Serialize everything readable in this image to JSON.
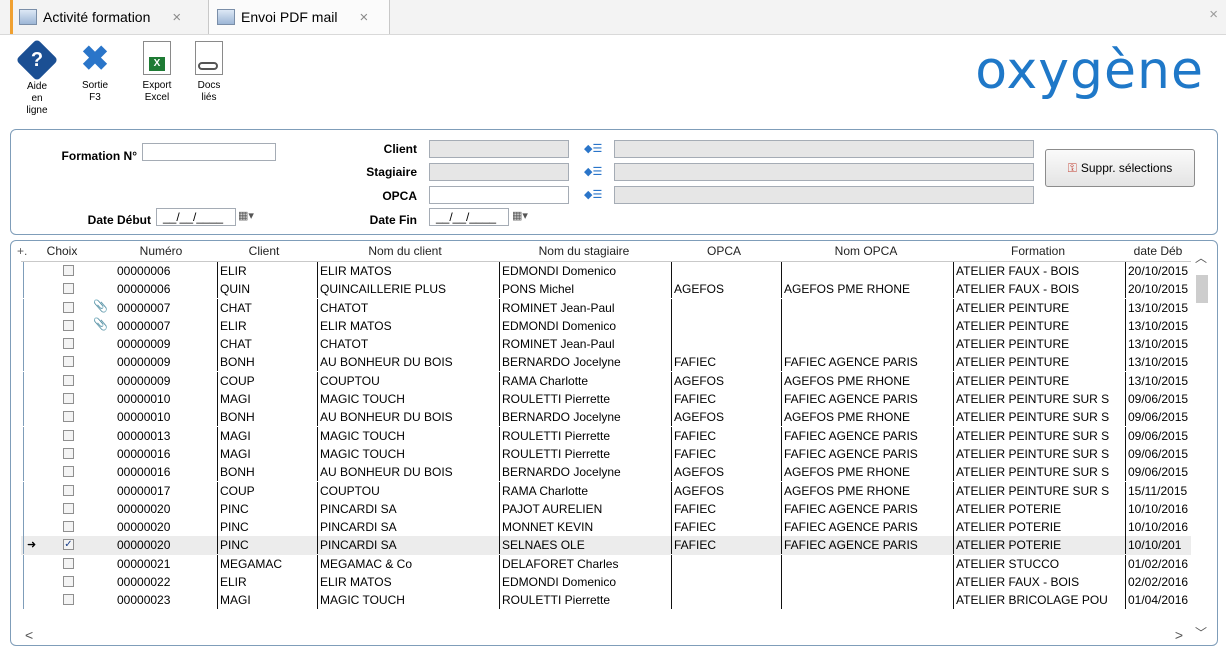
{
  "tabs": [
    {
      "label": "Activité formation",
      "close": "×"
    },
    {
      "label": "Envoi PDF mail",
      "close": "×"
    }
  ],
  "window_close": "×",
  "toolbar": {
    "help": {
      "line1": "Aide",
      "line2": "en",
      "line3": "ligne"
    },
    "exit": {
      "line1": "Sortie",
      "line2": "F3"
    },
    "export": {
      "line1": "Export",
      "line2": "Excel"
    },
    "docs": {
      "line1": "Docs",
      "line2": "liés"
    }
  },
  "logo": "oxygène",
  "filters": {
    "formation_label": "Formation N°",
    "formation_value": "",
    "date_debut_label": "Date Début",
    "date_debut_value": "__/__/____",
    "client_label": "Client",
    "stagiaire_label": "Stagiaire",
    "opca_label": "OPCA",
    "date_fin_label": "Date Fin",
    "date_fin_value": "__/__/____",
    "suppr_label": "Suppr. sélections"
  },
  "grid": {
    "columns": {
      "choix": "Choix",
      "numero": "Numéro",
      "client": "Client",
      "nom_client": "Nom du client",
      "nom_stagiaire": "Nom du stagiaire",
      "opca": "OPCA",
      "nom_opca": "Nom OPCA",
      "formation": "Formation",
      "date_debut": "date Déb"
    },
    "rows": [
      {
        "checked": false,
        "clip": false,
        "numero": "00000006",
        "client": "ELIR",
        "nom_client": "ELIR MATOS",
        "stagiaire": "EDMONDI Domenico",
        "opca": "",
        "nom_opca": "",
        "formation": "ATELIER FAUX - BOIS",
        "date": "20/10/2015"
      },
      {
        "checked": false,
        "clip": false,
        "numero": "00000006",
        "client": "QUIN",
        "nom_client": "QUINCAILLERIE PLUS",
        "stagiaire": "PONS Michel",
        "opca": "AGEFOS",
        "nom_opca": "AGEFOS PME RHONE",
        "formation": "ATELIER FAUX - BOIS",
        "date": "20/10/2015"
      },
      {
        "checked": false,
        "clip": true,
        "numero": "00000007",
        "client": "CHAT",
        "nom_client": "CHATOT",
        "stagiaire": "ROMINET Jean-Paul",
        "opca": "",
        "nom_opca": "",
        "formation": "ATELIER PEINTURE",
        "date": "13/10/2015"
      },
      {
        "checked": false,
        "clip": true,
        "numero": "00000007",
        "client": "ELIR",
        "nom_client": "ELIR MATOS",
        "stagiaire": "EDMONDI Domenico",
        "opca": "",
        "nom_opca": "",
        "formation": "ATELIER PEINTURE",
        "date": "13/10/2015"
      },
      {
        "checked": false,
        "clip": false,
        "numero": "00000009",
        "client": "CHAT",
        "nom_client": "CHATOT",
        "stagiaire": "ROMINET Jean-Paul",
        "opca": "",
        "nom_opca": "",
        "formation": "ATELIER PEINTURE",
        "date": "13/10/2015"
      },
      {
        "checked": false,
        "clip": false,
        "numero": "00000009",
        "client": "BONH",
        "nom_client": "AU BONHEUR DU BOIS",
        "stagiaire": "BERNARDO Jocelyne",
        "opca": "FAFIEC",
        "nom_opca": "FAFIEC AGENCE PARIS",
        "formation": "ATELIER PEINTURE",
        "date": "13/10/2015"
      },
      {
        "checked": false,
        "clip": false,
        "numero": "00000009",
        "client": "COUP",
        "nom_client": "COUPTOU",
        "stagiaire": "RAMA Charlotte",
        "opca": "AGEFOS",
        "nom_opca": "AGEFOS PME RHONE",
        "formation": "ATELIER PEINTURE",
        "date": "13/10/2015"
      },
      {
        "checked": false,
        "clip": false,
        "numero": "00000010",
        "client": "MAGI",
        "nom_client": "MAGIC TOUCH",
        "stagiaire": "ROULETTI Pierrette",
        "opca": "FAFIEC",
        "nom_opca": "FAFIEC AGENCE PARIS",
        "formation": "ATELIER PEINTURE SUR S",
        "date": "09/06/2015"
      },
      {
        "checked": false,
        "clip": false,
        "numero": "00000010",
        "client": "BONH",
        "nom_client": "AU BONHEUR DU BOIS",
        "stagiaire": "BERNARDO Jocelyne",
        "opca": "AGEFOS",
        "nom_opca": "AGEFOS PME RHONE",
        "formation": "ATELIER PEINTURE SUR S",
        "date": "09/06/2015"
      },
      {
        "checked": false,
        "clip": false,
        "numero": "00000013",
        "client": "MAGI",
        "nom_client": "MAGIC TOUCH",
        "stagiaire": "ROULETTI Pierrette",
        "opca": "FAFIEC",
        "nom_opca": "FAFIEC AGENCE PARIS",
        "formation": "ATELIER PEINTURE SUR S",
        "date": "09/06/2015"
      },
      {
        "checked": false,
        "clip": false,
        "numero": "00000016",
        "client": "MAGI",
        "nom_client": "MAGIC TOUCH",
        "stagiaire": "ROULETTI Pierrette",
        "opca": "FAFIEC",
        "nom_opca": "FAFIEC AGENCE PARIS",
        "formation": "ATELIER PEINTURE SUR S",
        "date": "09/06/2015"
      },
      {
        "checked": false,
        "clip": false,
        "numero": "00000016",
        "client": "BONH",
        "nom_client": "AU BONHEUR DU BOIS",
        "stagiaire": "BERNARDO Jocelyne",
        "opca": "AGEFOS",
        "nom_opca": "AGEFOS PME RHONE",
        "formation": "ATELIER PEINTURE SUR S",
        "date": "09/06/2015"
      },
      {
        "checked": false,
        "clip": false,
        "numero": "00000017",
        "client": "COUP",
        "nom_client": "COUPTOU",
        "stagiaire": "RAMA Charlotte",
        "opca": "AGEFOS",
        "nom_opca": "AGEFOS PME RHONE",
        "formation": "ATELIER PEINTURE SUR S",
        "date": "15/11/2015"
      },
      {
        "checked": false,
        "clip": false,
        "numero": "00000020",
        "client": "PINC",
        "nom_client": "PINCARDI SA",
        "stagiaire": "PAJOT AURELIEN",
        "opca": "FAFIEC",
        "nom_opca": "FAFIEC AGENCE PARIS",
        "formation": "ATELIER POTERIE",
        "date": "10/10/2016"
      },
      {
        "checked": false,
        "clip": false,
        "numero": "00000020",
        "client": "PINC",
        "nom_client": "PINCARDI SA",
        "stagiaire": "MONNET KEVIN",
        "opca": "FAFIEC",
        "nom_opca": "FAFIEC AGENCE PARIS",
        "formation": "ATELIER POTERIE",
        "date": "10/10/2016"
      },
      {
        "checked": true,
        "clip": false,
        "selected": true,
        "numero": "00000020",
        "client": "PINC",
        "nom_client": "PINCARDI SA",
        "stagiaire": "SELNAES OLE",
        "opca": "FAFIEC",
        "nom_opca": "FAFIEC AGENCE PARIS",
        "formation": "ATELIER POTERIE",
        "date": "10/10/201"
      },
      {
        "checked": false,
        "clip": false,
        "numero": "00000021",
        "client": "MEGAMAC",
        "nom_client": "MEGAMAC & Co",
        "stagiaire": "DELAFORET Charles",
        "opca": "",
        "nom_opca": "",
        "formation": "ATELIER STUCCO",
        "date": "01/02/2016"
      },
      {
        "checked": false,
        "clip": false,
        "numero": "00000022",
        "client": "ELIR",
        "nom_client": "ELIR MATOS",
        "stagiaire": "EDMONDI Domenico",
        "opca": "",
        "nom_opca": "",
        "formation": "ATELIER FAUX - BOIS",
        "date": "02/02/2016"
      },
      {
        "checked": false,
        "clip": false,
        "numero": "00000023",
        "client": "MAGI",
        "nom_client": "MAGIC TOUCH",
        "stagiaire": "ROULETTI Pierrette",
        "opca": "",
        "nom_opca": "",
        "formation": "ATELIER BRICOLAGE POU",
        "date": "01/04/2016"
      }
    ]
  },
  "icons": {
    "tab": "grid-icon",
    "help": "help-icon",
    "exit": "close-x-icon",
    "export": "excel-icon",
    "docs": "linked-docs-icon",
    "picker": "list-picker-icon",
    "calendar": "calendar-icon",
    "key": "key-icon",
    "clip": "paperclip-icon"
  },
  "colors": {
    "accent": "#1f78c8",
    "panel_border": "#7f9db9",
    "tab_marker": "#f0a030"
  }
}
